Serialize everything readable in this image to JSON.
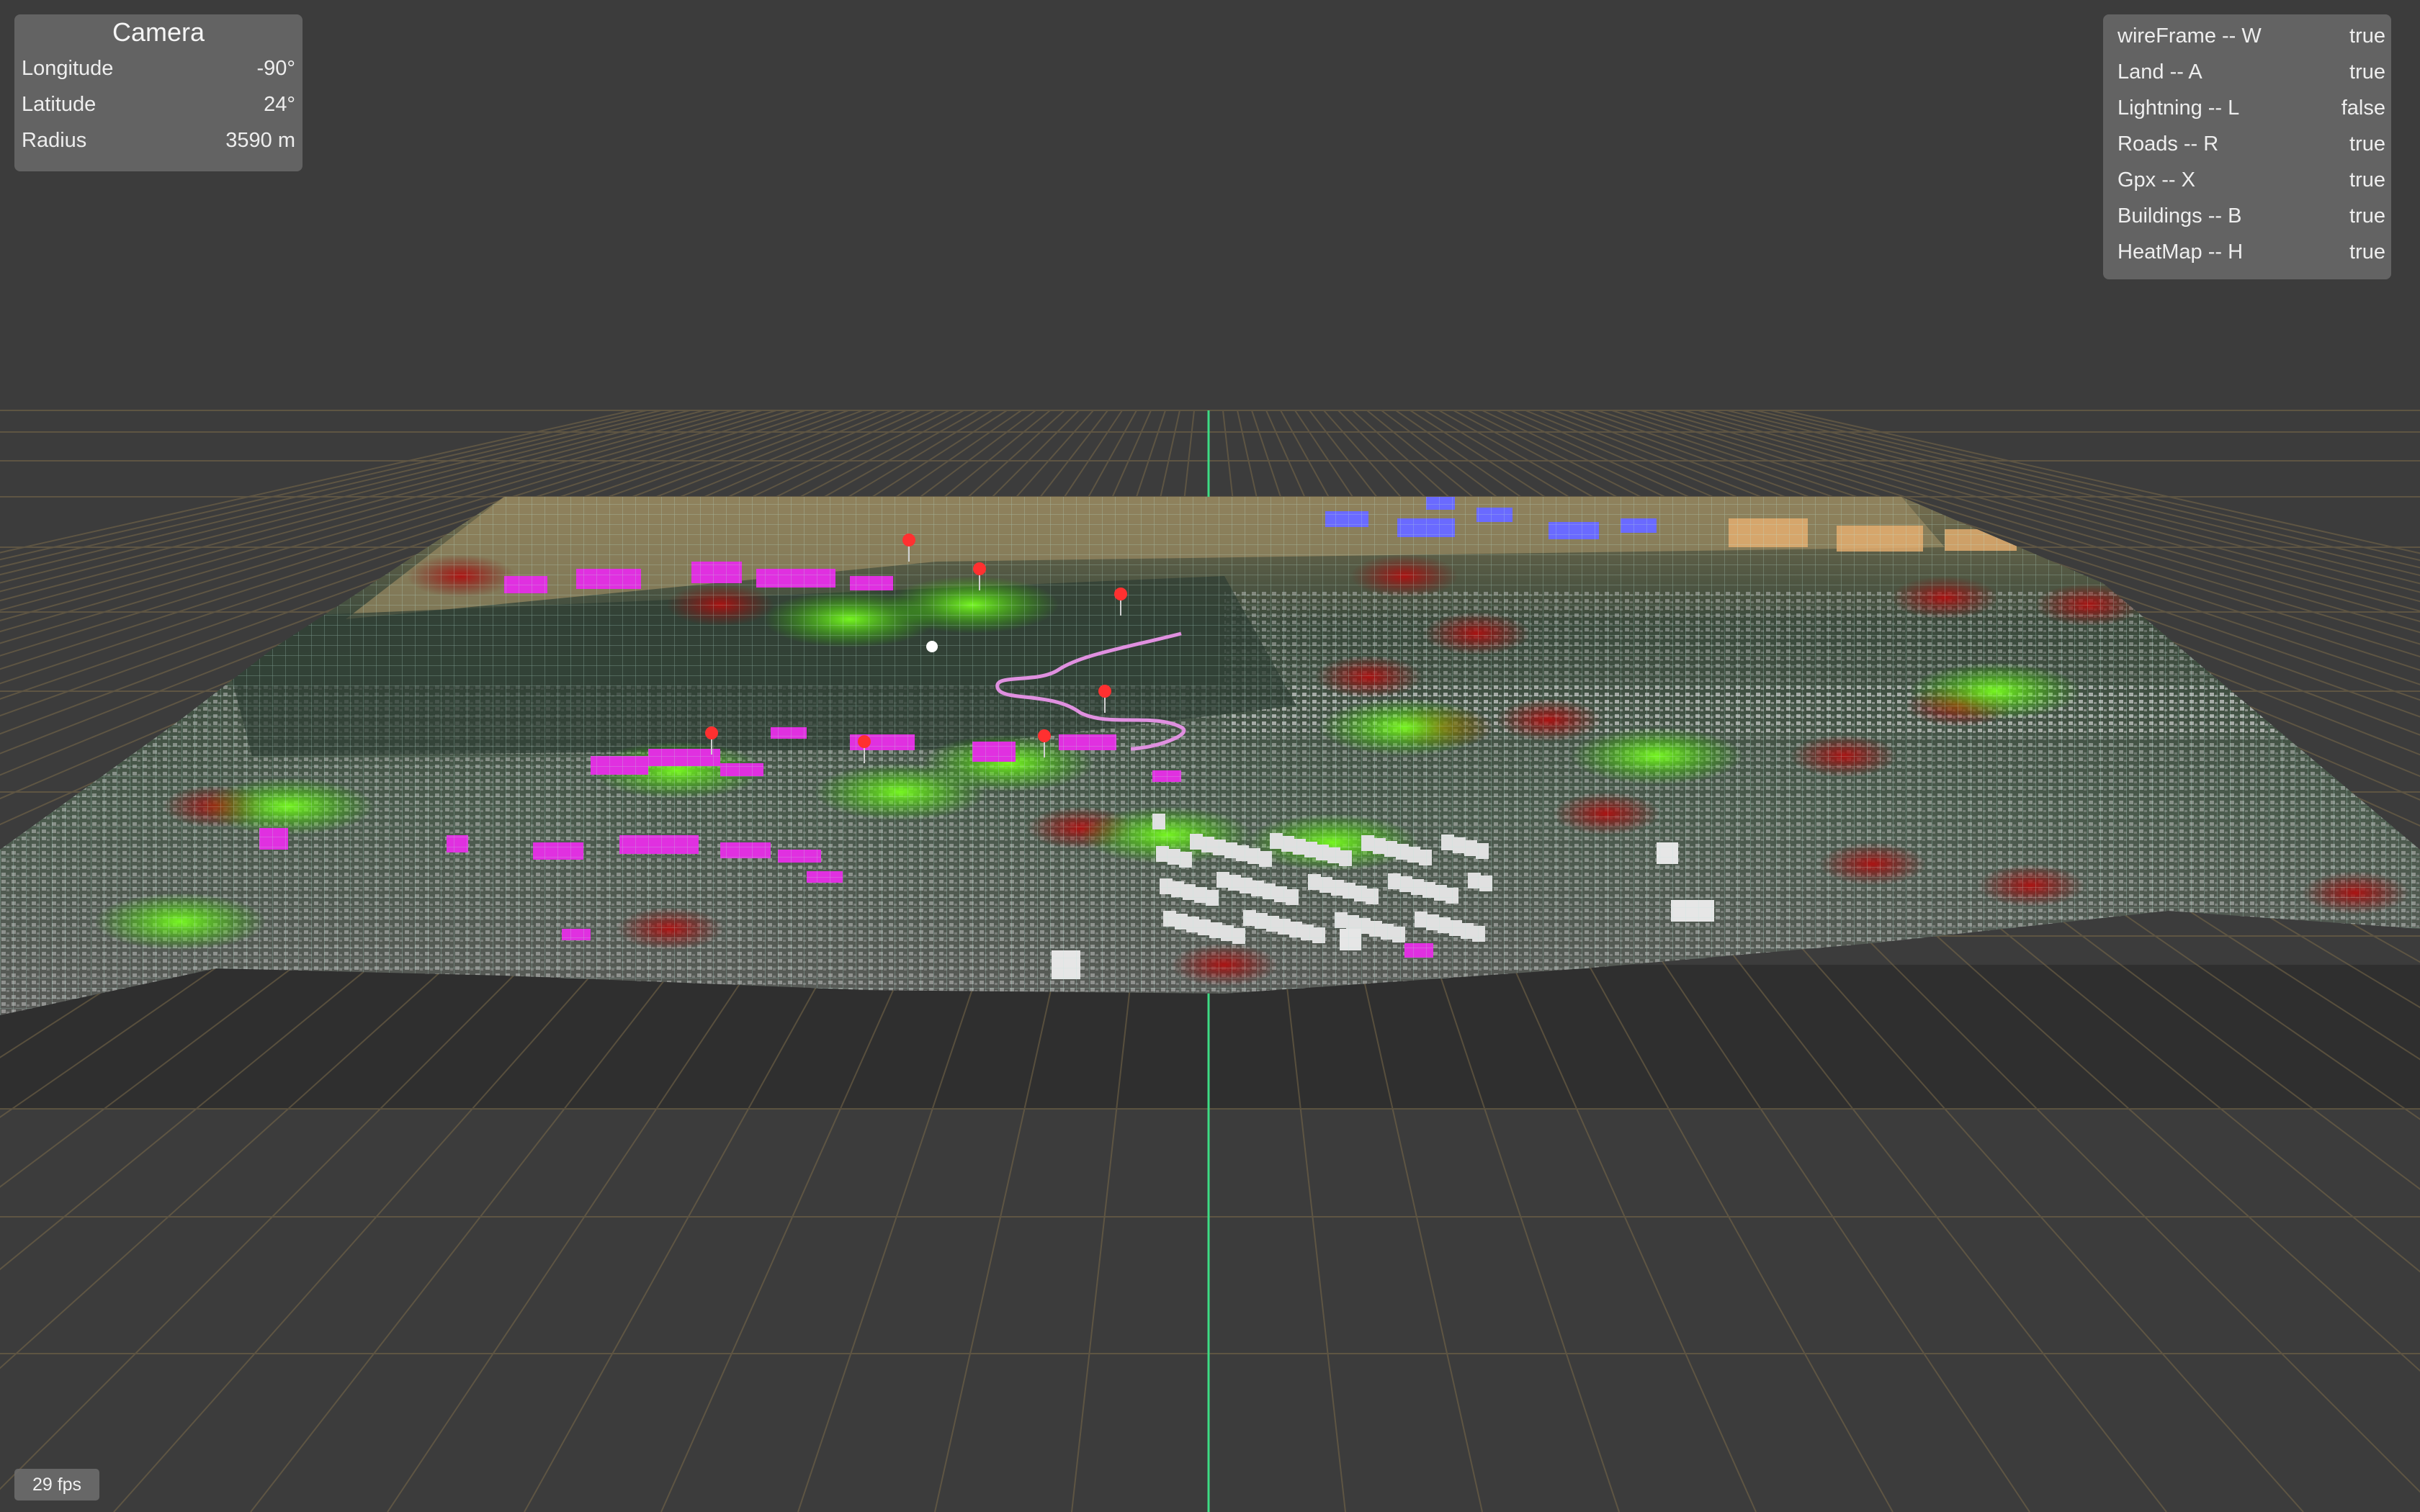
{
  "camera": {
    "title": "Camera",
    "rows": [
      {
        "label": "Longitude",
        "value": "-90°"
      },
      {
        "label": "Latitude",
        "value": "24°"
      },
      {
        "label": "Radius",
        "value": "3590 m"
      }
    ]
  },
  "toggles": [
    {
      "label": "wireFrame -- W",
      "value": "true"
    },
    {
      "label": "Land -- A",
      "value": "true"
    },
    {
      "label": "Lightning -- L",
      "value": "false"
    },
    {
      "label": "Roads -- R",
      "value": "true"
    },
    {
      "label": "Gpx -- X",
      "value": "true"
    },
    {
      "label": "Buildings -- B",
      "value": "true"
    },
    {
      "label": "HeatMap -- H",
      "value": "true"
    }
  ],
  "status": {
    "fps": "29 fps"
  },
  "colors": {
    "background": "#3c3c3c",
    "grid_line": "#7a6a4a",
    "axis_line": "#3ddc84",
    "wireframe": "#9fe0d0",
    "buildings": "#d8d8d8",
    "highlight_buildings": "#e030e0",
    "blue_buildings": "#6a6aff",
    "heat_green": "#55e000",
    "heat_red": "#a01010",
    "gpx_track": "#e080e0",
    "markers": "#ff3030"
  }
}
